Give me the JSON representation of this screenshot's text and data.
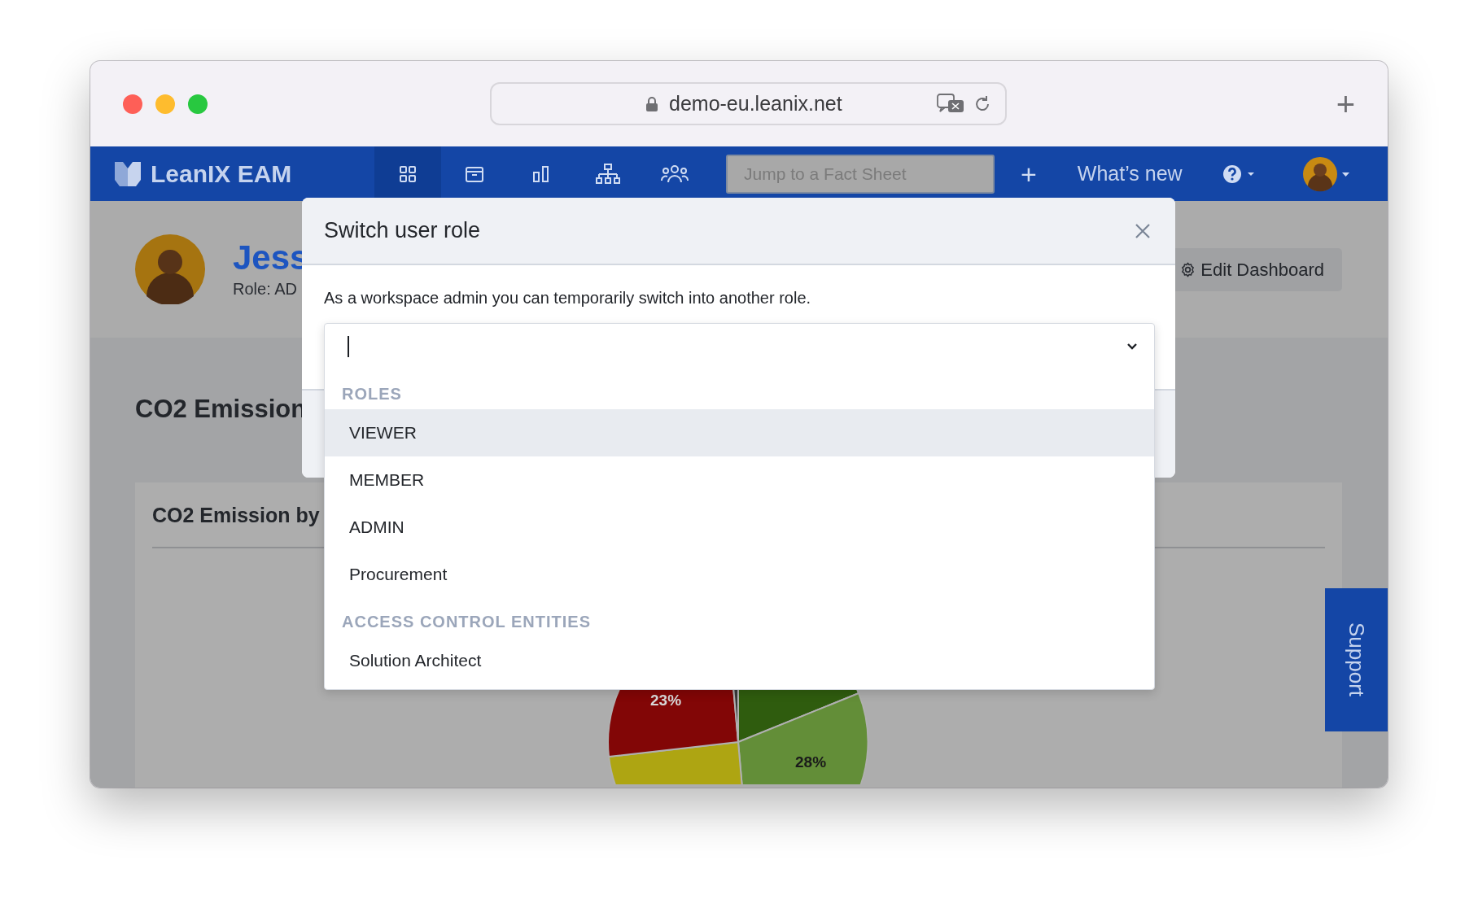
{
  "browser": {
    "url": "demo-eu.leanix.net",
    "new_tab": "+"
  },
  "nav": {
    "brand": "LeanIX EAM",
    "tabs": [
      {
        "kind": "dashboard",
        "selected": true
      },
      {
        "kind": "inventory",
        "selected": false
      },
      {
        "kind": "reports",
        "selected": false
      },
      {
        "kind": "diagrams",
        "selected": false
      },
      {
        "kind": "people",
        "selected": false
      }
    ],
    "search": {
      "placeholder": "Jump to a Fact Sheet"
    },
    "add": "+",
    "whats_new": "What’s new"
  },
  "profile": {
    "name": "Jess",
    "role": "Role: AD"
  },
  "edit_button": "Edit Dashboard",
  "section_title": "CO2 Emission",
  "card": {
    "title": "CO2 Emission by",
    "slice_labels": [
      "23%",
      "28%"
    ]
  },
  "support": "Support",
  "modal": {
    "title": "Switch user role",
    "description": "As a workspace admin you can temporarily switch into another role.",
    "groups": [
      {
        "heading": "ROLES",
        "options": [
          {
            "label": "VIEWER",
            "selected": true
          },
          {
            "label": "MEMBER",
            "selected": false
          },
          {
            "label": "ADMIN",
            "selected": false
          },
          {
            "label": "Procurement",
            "selected": false
          }
        ]
      },
      {
        "heading": "ACCESS CONTROL ENTITIES",
        "options": [
          {
            "label": "Solution Architect",
            "selected": false
          }
        ]
      }
    ]
  }
}
